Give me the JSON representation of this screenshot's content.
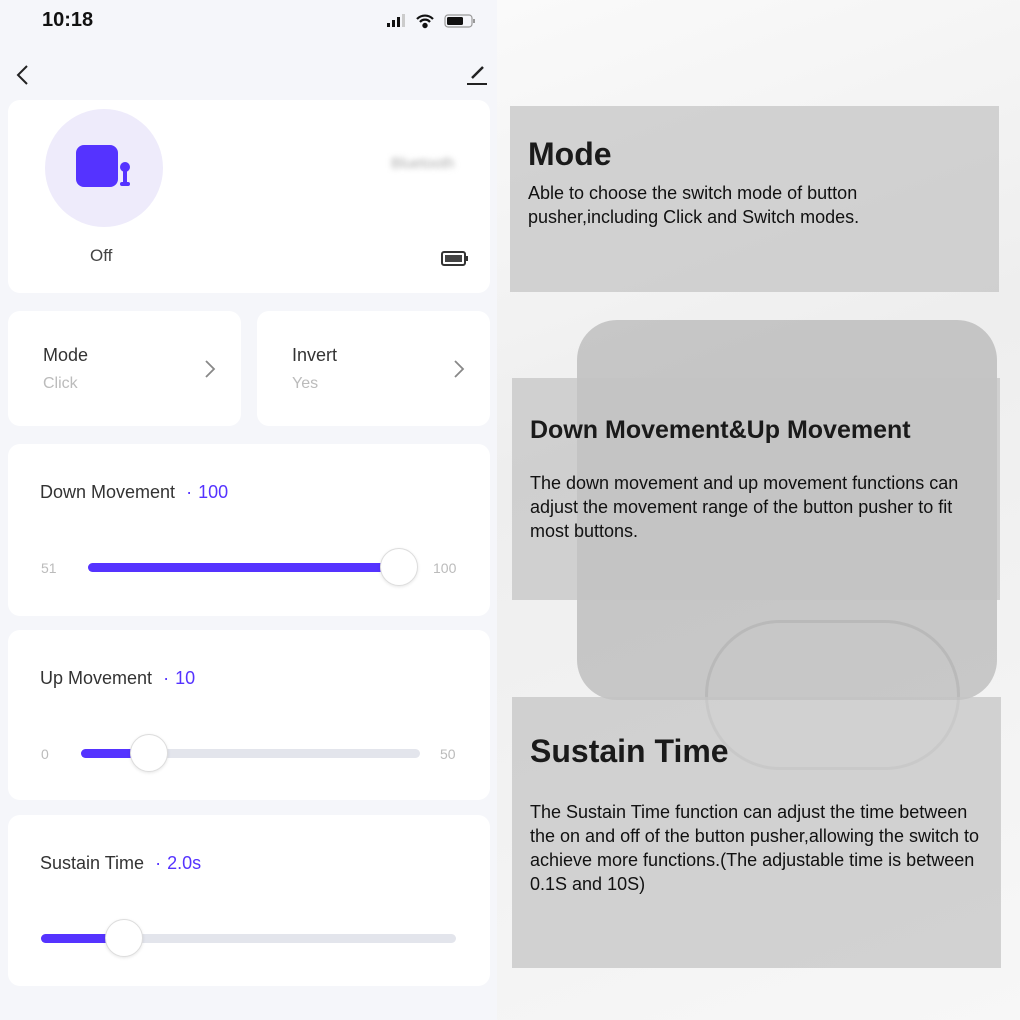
{
  "status_bar": {
    "time": "10:18",
    "icons": [
      "signal-icon",
      "wifi-icon",
      "battery-icon"
    ]
  },
  "nav": {
    "back_icon": "chevron-left-icon",
    "edit_icon": "pencil-icon"
  },
  "device": {
    "state": "Off",
    "connection": "Bluetooth",
    "icon": "button-pusher-icon",
    "battery_icon": "battery-icon"
  },
  "settings": [
    {
      "label": "Mode",
      "value": "Click"
    },
    {
      "label": "Invert",
      "value": "Yes"
    }
  ],
  "sliders": [
    {
      "label": "Down Movement",
      "sep": "·",
      "value": "100",
      "min": "51",
      "max": "100",
      "fraction": 1.0
    },
    {
      "label": "Up Movement",
      "sep": "·",
      "value": "10",
      "min": "0",
      "max": "50",
      "fraction": 0.2
    },
    {
      "label": "Sustain Time",
      "sep": "·",
      "value": "2.0s",
      "fraction": 0.2
    }
  ],
  "info": [
    {
      "title": "Mode",
      "text": "Able to choose the switch mode of button pusher,including Click and Switch modes."
    },
    {
      "title": "Down Movement&Up Movement",
      "text": "The down movement and up movement functions can adjust the movement range of the button pusher to fit most buttons."
    },
    {
      "title": "Sustain Time",
      "text": "The Sustain Time function can adjust the time between the on and off of the button pusher,allowing the switch to achieve more functions.(The adjustable time is between 0.1S and 10S)"
    }
  ],
  "colors": {
    "accent": "#5533ff",
    "background": "#f5f6fa"
  }
}
